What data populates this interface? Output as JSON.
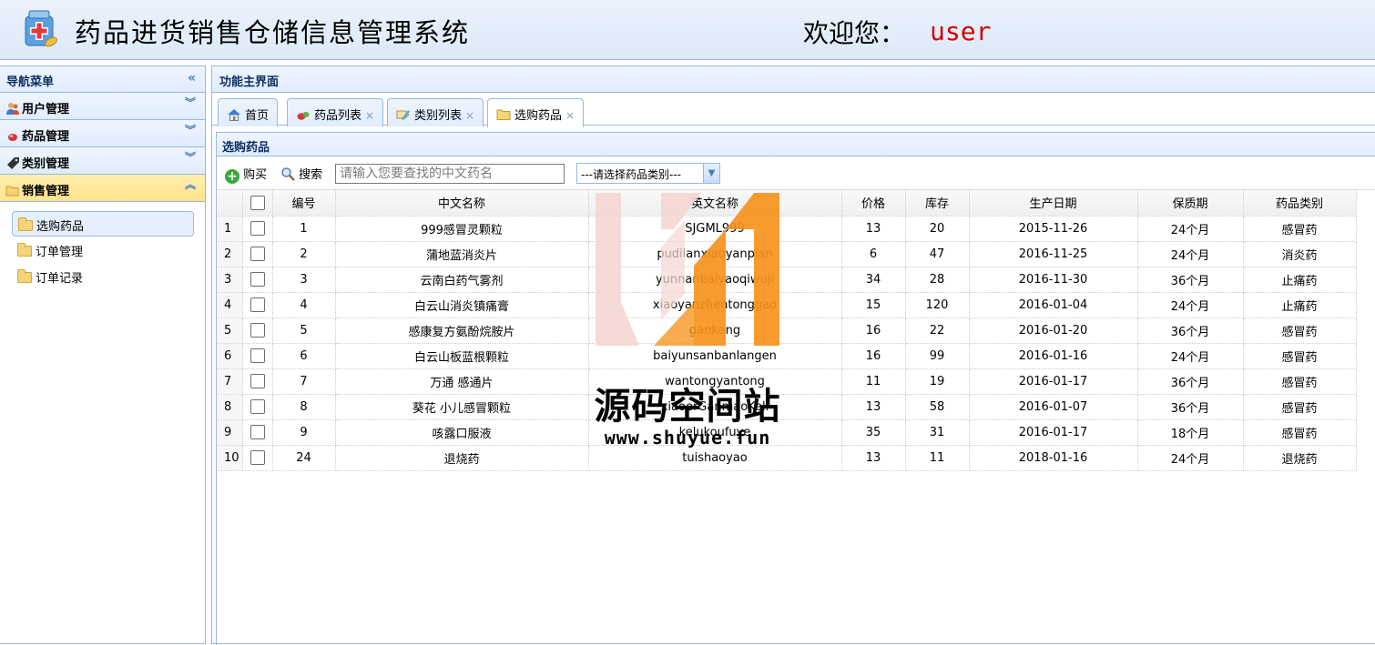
{
  "header": {
    "app_title": "药品进货销售仓储信息管理系统",
    "welcome_label": "欢迎您：",
    "username": "user"
  },
  "nav": {
    "title": "导航菜单",
    "groups": [
      {
        "label": "用户管理",
        "icon": "users-icon",
        "expanded": false
      },
      {
        "label": "药品管理",
        "icon": "pill-icon",
        "expanded": false
      },
      {
        "label": "类别管理",
        "icon": "tag-icon",
        "expanded": false
      },
      {
        "label": "销售管理",
        "icon": "folder-open-icon",
        "expanded": true
      }
    ],
    "sub_items": [
      {
        "label": "选购药品",
        "selected": true
      },
      {
        "label": "订单管理",
        "selected": false
      },
      {
        "label": "订单记录",
        "selected": false
      }
    ]
  },
  "main": {
    "title": "功能主界面",
    "tabs": [
      {
        "label": "首页",
        "icon": "home-icon",
        "closable": false
      },
      {
        "label": "药品列表",
        "icon": "pill-icon",
        "closable": true
      },
      {
        "label": "类别列表",
        "icon": "tag-edit-icon",
        "closable": true
      },
      {
        "label": "选购药品",
        "icon": "folder-icon",
        "closable": true,
        "active": true
      }
    ],
    "panel_title": "选购药品",
    "toolbar": {
      "buy_label": "购买",
      "search_label": "搜索",
      "search_placeholder": "请输入您要查找的中文药名",
      "category_select": "---请选择药品类别---"
    },
    "columns": [
      "编号",
      "中文名称",
      "英文名称",
      "价格",
      "库存",
      "生产日期",
      "保质期",
      "药品类别"
    ],
    "rows": [
      {
        "n": "1",
        "id": "1",
        "cn": "999感冒灵颗粒",
        "en": "SJGML999",
        "price": "13",
        "stock": "20",
        "date": "2015-11-26",
        "shelf": "24个月",
        "cat": "感冒药"
      },
      {
        "n": "2",
        "id": "2",
        "cn": "蒲地蓝消炎片",
        "en": "pudilanxiaoyanpian",
        "price": "6",
        "stock": "47",
        "date": "2016-11-25",
        "shelf": "24个月",
        "cat": "消炎药"
      },
      {
        "n": "3",
        "id": "3",
        "cn": "云南白药气雾剂",
        "en": "yunnanbaiyaoqiwuji",
        "price": "34",
        "stock": "28",
        "date": "2016-11-30",
        "shelf": "36个月",
        "cat": "止痛药"
      },
      {
        "n": "4",
        "id": "4",
        "cn": "白云山消炎镇痛膏",
        "en": "xiaoyanzhentonggao",
        "price": "15",
        "stock": "120",
        "date": "2016-01-04",
        "shelf": "24个月",
        "cat": "止痛药"
      },
      {
        "n": "5",
        "id": "5",
        "cn": "感康复方氨酚烷胺片",
        "en": "gankang",
        "price": "16",
        "stock": "22",
        "date": "2016-01-20",
        "shelf": "36个月",
        "cat": "感冒药"
      },
      {
        "n": "6",
        "id": "6",
        "cn": "白云山板蓝根颗粒",
        "en": "baiyunsanbanlangen",
        "price": "16",
        "stock": "99",
        "date": "2016-01-16",
        "shelf": "24个月",
        "cat": "感冒药"
      },
      {
        "n": "7",
        "id": "7",
        "cn": "万通 感通片",
        "en": "wantongyantong",
        "price": "11",
        "stock": "19",
        "date": "2016-01-17",
        "shelf": "36个月",
        "cat": "感冒药"
      },
      {
        "n": "8",
        "id": "8",
        "cn": "葵花 小儿感冒颗粒",
        "en": "xiaoerGanmaoKeli",
        "price": "13",
        "stock": "58",
        "date": "2016-01-07",
        "shelf": "36个月",
        "cat": "感冒药"
      },
      {
        "n": "9",
        "id": "9",
        "cn": "咳露口服液",
        "en": "kelukoufuye",
        "price": "35",
        "stock": "31",
        "date": "2016-01-17",
        "shelf": "18个月",
        "cat": "感冒药"
      },
      {
        "n": "10",
        "id": "24",
        "cn": "退烧药",
        "en": "tuishaoyao",
        "price": "13",
        "stock": "11",
        "date": "2018-01-16",
        "shelf": "24个月",
        "cat": "退烧药"
      }
    ]
  },
  "watermark": {
    "text": "源码空间站",
    "url": "www.shuyue.fun"
  },
  "colors": {
    "header_bg": "#dde9f8",
    "panel_border": "#95b8e7",
    "active_group_bg": "#ffe48d",
    "username": "#d00000",
    "watermark_orange": "#f7931e",
    "watermark_pink": "#f5d7d3"
  }
}
